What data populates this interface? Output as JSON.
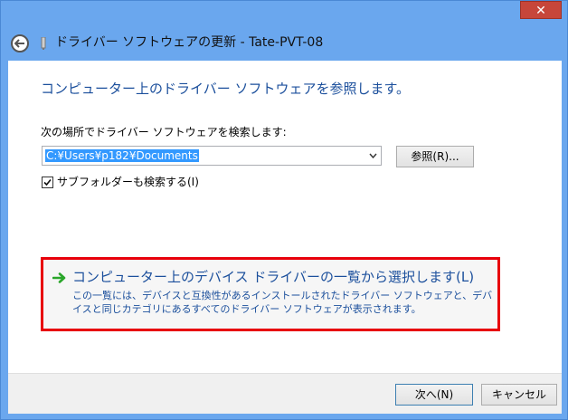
{
  "window": {
    "title": "ドライバー ソフトウェアの更新 - Tate-PVT-08",
    "close_label": "✕"
  },
  "content": {
    "heading": "コンピューター上のドライバー ソフトウェアを参照します。",
    "search_label": "次の場所でドライバー ソフトウェアを検索します:",
    "path_value": "C:¥Users¥p182¥Documents",
    "browse_label": "参照(R)...",
    "include_subfolders_label": "サブフォルダーも検索する(I)",
    "include_subfolders_checked": true,
    "option": {
      "title": "コンピューター上のデバイス ドライバーの一覧から選択します(L)",
      "description": "この一覧には、デバイスと互換性があるインストールされたドライバー ソフトウェアと、デバイスと同じカテゴリにあるすべてのドライバー ソフトウェアが表示されます。"
    }
  },
  "footer": {
    "next_label": "次へ(N)",
    "cancel_label": "キャンセル"
  },
  "colors": {
    "accent_text": "#1b4f9c",
    "highlight_border": "#e8000b",
    "selection": "#3399ff",
    "close_button": "#c7463a"
  },
  "icons": {
    "back": "back-arrow-icon",
    "option_arrow": "green-arrow-icon",
    "combo": "chevron-down-icon",
    "check": "checkmark-icon"
  }
}
